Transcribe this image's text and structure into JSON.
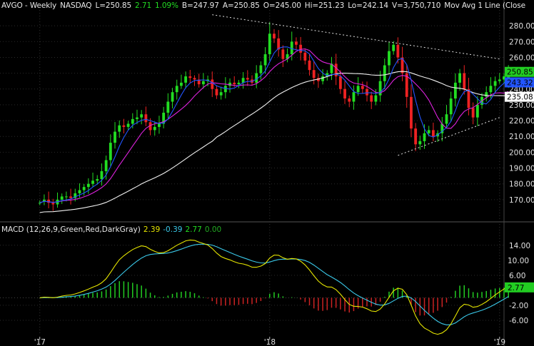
{
  "header": {
    "symbol": "AVGO - Weekly",
    "exchange": "NASDAQ",
    "last": "L=250.85",
    "change": "2.71",
    "change_pct": "1.09%",
    "bid": "B=247.97",
    "ask": "A=250.85",
    "open": "O=245.00",
    "high": "Hi=251.23",
    "low": "Lo=242.14",
    "volume": "V=3,750,710",
    "study": "Mov Avg 1 Line (Close"
  },
  "macd_header": {
    "label": "MACD (12,26,9,Green,Red,DarkGray)",
    "macd": "2.39",
    "signal": "-0.39",
    "hist": "2.77",
    "zero": "0.00"
  },
  "colors": {
    "up": "#22dd22",
    "down": "#ee2222",
    "ma_short": "#2255ff",
    "ma_mid": "#dd22dd",
    "ma_long": "#f0f0f0",
    "macd_line": "#e6e600",
    "signal_line": "#3ac8e8",
    "hist_up": "#22cc22",
    "hist_down": "#cc2222",
    "grid": "#2a2a2a"
  },
  "chart_data": [
    {
      "type": "candlestick",
      "title": "AVGO - Weekly NASDAQ",
      "ylim": [
        160,
        290
      ],
      "price_ticks": [
        "280.00",
        "270.00",
        "260.00",
        "250.00",
        "240.00",
        "230.00",
        "220.00",
        "210.00",
        "200.00",
        "190.00",
        "180.00",
        "170.00"
      ],
      "price_tick_values": [
        280,
        270,
        260,
        250,
        240,
        230,
        220,
        210,
        200,
        190,
        180,
        170
      ],
      "price_labels": [
        {
          "text": "250.85",
          "value": 250.85,
          "color": "#22cc22"
        },
        {
          "text": "243.32",
          "value": 244.2,
          "color": "#2255ff"
        },
        {
          "text": "235.08",
          "value": 235.08,
          "color": "#ffffff"
        }
      ],
      "x_ticks": [
        "'17",
        "'18",
        "'19"
      ],
      "x_tick_index": [
        0,
        52,
        104
      ],
      "week_range": [
        -9,
        105
      ],
      "closes": [
        168,
        170,
        168,
        167,
        170,
        172,
        172,
        171,
        174,
        176,
        178,
        180,
        182,
        183,
        188,
        195,
        206,
        213,
        217,
        216,
        218,
        221,
        222,
        224,
        219,
        214,
        216,
        218,
        225,
        232,
        238,
        242,
        244,
        248,
        247,
        246,
        243,
        245,
        246,
        240,
        236,
        238,
        242,
        244,
        243,
        244,
        247,
        246,
        244,
        250,
        255,
        262,
        275,
        272,
        265,
        259,
        262,
        270,
        268,
        263,
        258,
        252,
        247,
        245,
        248,
        250,
        256,
        248,
        240,
        234,
        232,
        238,
        242,
        240,
        236,
        232,
        236,
        245,
        255,
        264,
        268,
        260,
        250,
        235,
        215,
        205,
        207,
        212,
        214,
        210,
        212,
        218,
        224,
        234,
        244,
        250,
        240,
        228,
        222,
        230,
        235,
        238,
        242,
        245,
        246,
        248,
        250.85
      ],
      "opens": [
        168,
        169,
        170,
        168,
        167,
        170,
        172,
        172,
        171,
        174,
        176,
        178,
        180,
        182,
        183,
        188,
        195,
        206,
        213,
        217,
        216,
        218,
        221,
        222,
        224,
        219,
        214,
        216,
        218,
        225,
        232,
        238,
        242,
        244,
        248,
        247,
        246,
        243,
        245,
        246,
        240,
        236,
        238,
        242,
        244,
        243,
        244,
        247,
        246,
        244,
        250,
        255,
        262,
        275,
        272,
        265,
        259,
        262,
        270,
        268,
        263,
        258,
        252,
        247,
        245,
        248,
        250,
        256,
        248,
        240,
        234,
        232,
        238,
        242,
        240,
        236,
        232,
        236,
        245,
        255,
        264,
        268,
        260,
        250,
        235,
        215,
        205,
        207,
        212,
        214,
        210,
        212,
        218,
        224,
        234,
        244,
        250,
        240,
        228,
        222,
        230,
        235,
        238,
        242,
        245,
        246,
        245.0
      ]
    },
    {
      "type": "line",
      "title": "MACD (12,26,9,Green,Red,DarkGray)",
      "ylim": [
        -10,
        17
      ],
      "macd_ticks": [
        "14.00",
        "6.00",
        "-2.00",
        "-6.00"
      ],
      "macd_tick_values": [
        14,
        6,
        -2,
        -6
      ],
      "macd_labels": [
        {
          "text": "10.00",
          "value": 10,
          "color": "#ffffff"
        },
        {
          "text": "2.77",
          "value": 2.77,
          "color": "#22cc22"
        }
      ]
    }
  ]
}
